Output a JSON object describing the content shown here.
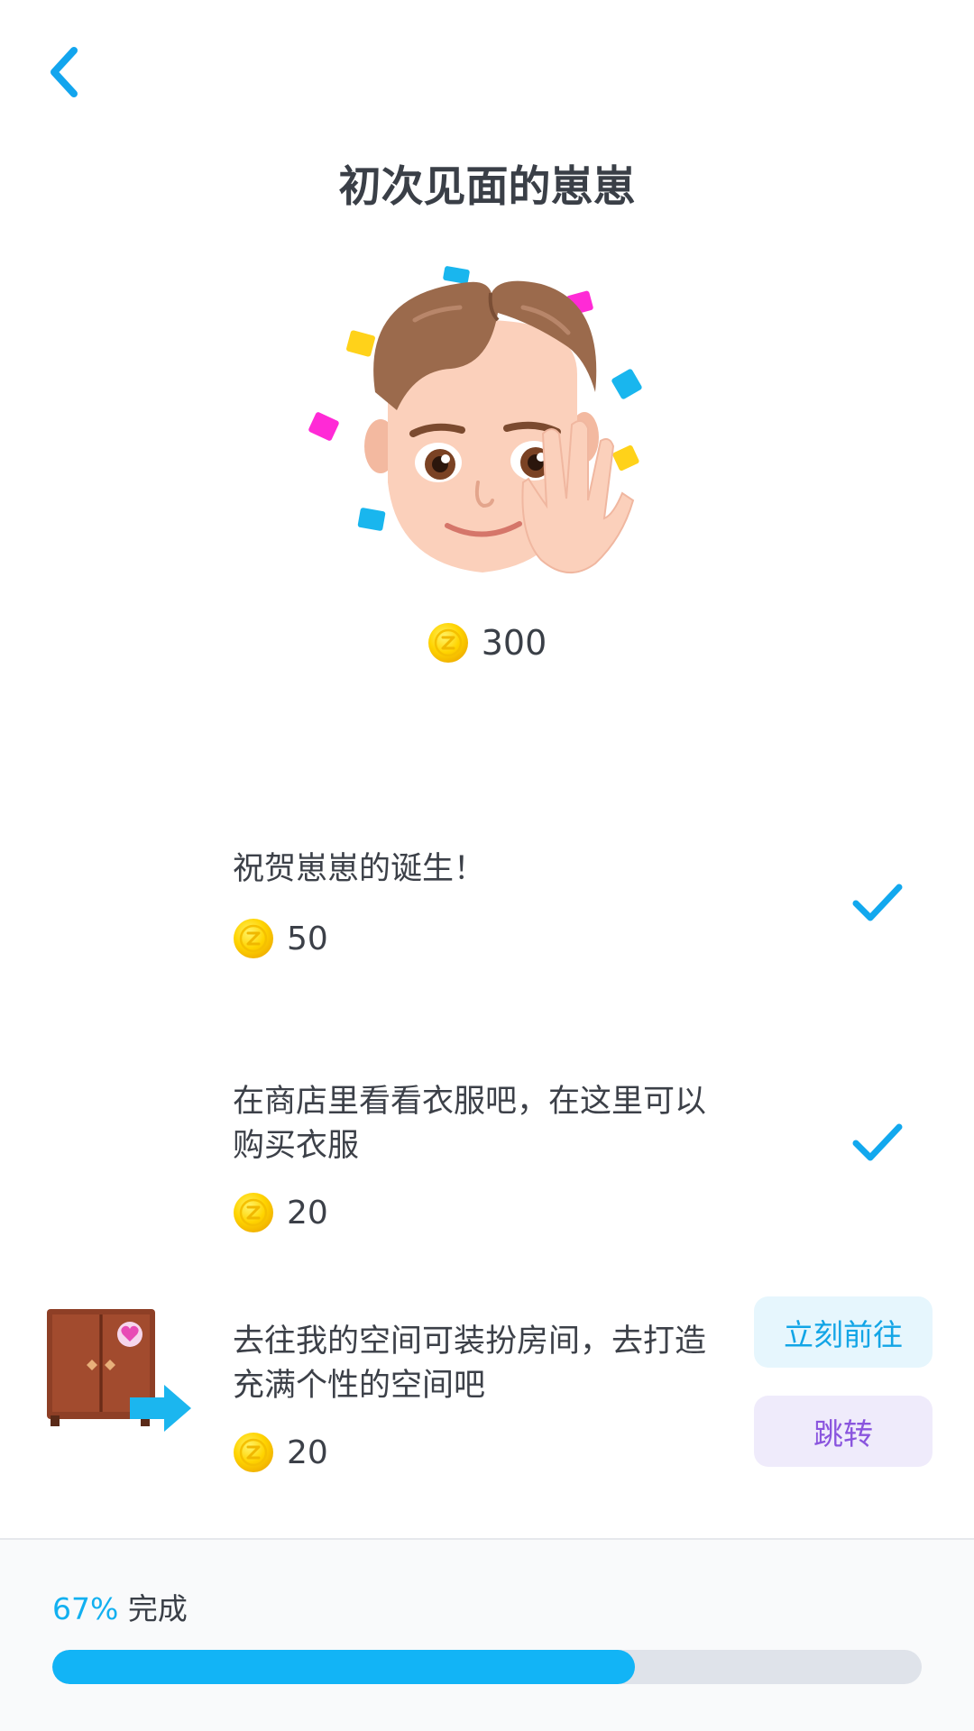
{
  "header": {
    "back_icon": "chevron-left-icon",
    "title": "初次见面的崽崽"
  },
  "hero": {
    "avatar_icon": "waving-avatar-with-confetti",
    "coin_icon": "gold-coin-icon",
    "total_reward": "300"
  },
  "tasks": [
    {
      "text": "祝贺崽崽的诞生！",
      "reward": "50",
      "status": "completed",
      "status_icon": "checkmark-icon"
    },
    {
      "text": "在商店里看看衣服吧，在这里可以购买衣服",
      "reward": "20",
      "status": "completed",
      "status_icon": "checkmark-icon"
    },
    {
      "text": "去往我的空间可装扮房间，去打造充满个性的空间吧",
      "reward": "20",
      "status": "pending",
      "thumb_icon": "wardrobe-with-arrow-icon",
      "go_label": "立刻前往",
      "jump_label": "跳转"
    }
  ],
  "footer": {
    "progress_percent_text": "67%",
    "progress_suffix": "完成",
    "progress_fraction": 0.67
  },
  "colors": {
    "accent_blue": "#12b4f6",
    "go_button_bg": "#e6f6fd",
    "jump_button_bg": "#efebfb",
    "jump_button_text": "#8a55de"
  }
}
